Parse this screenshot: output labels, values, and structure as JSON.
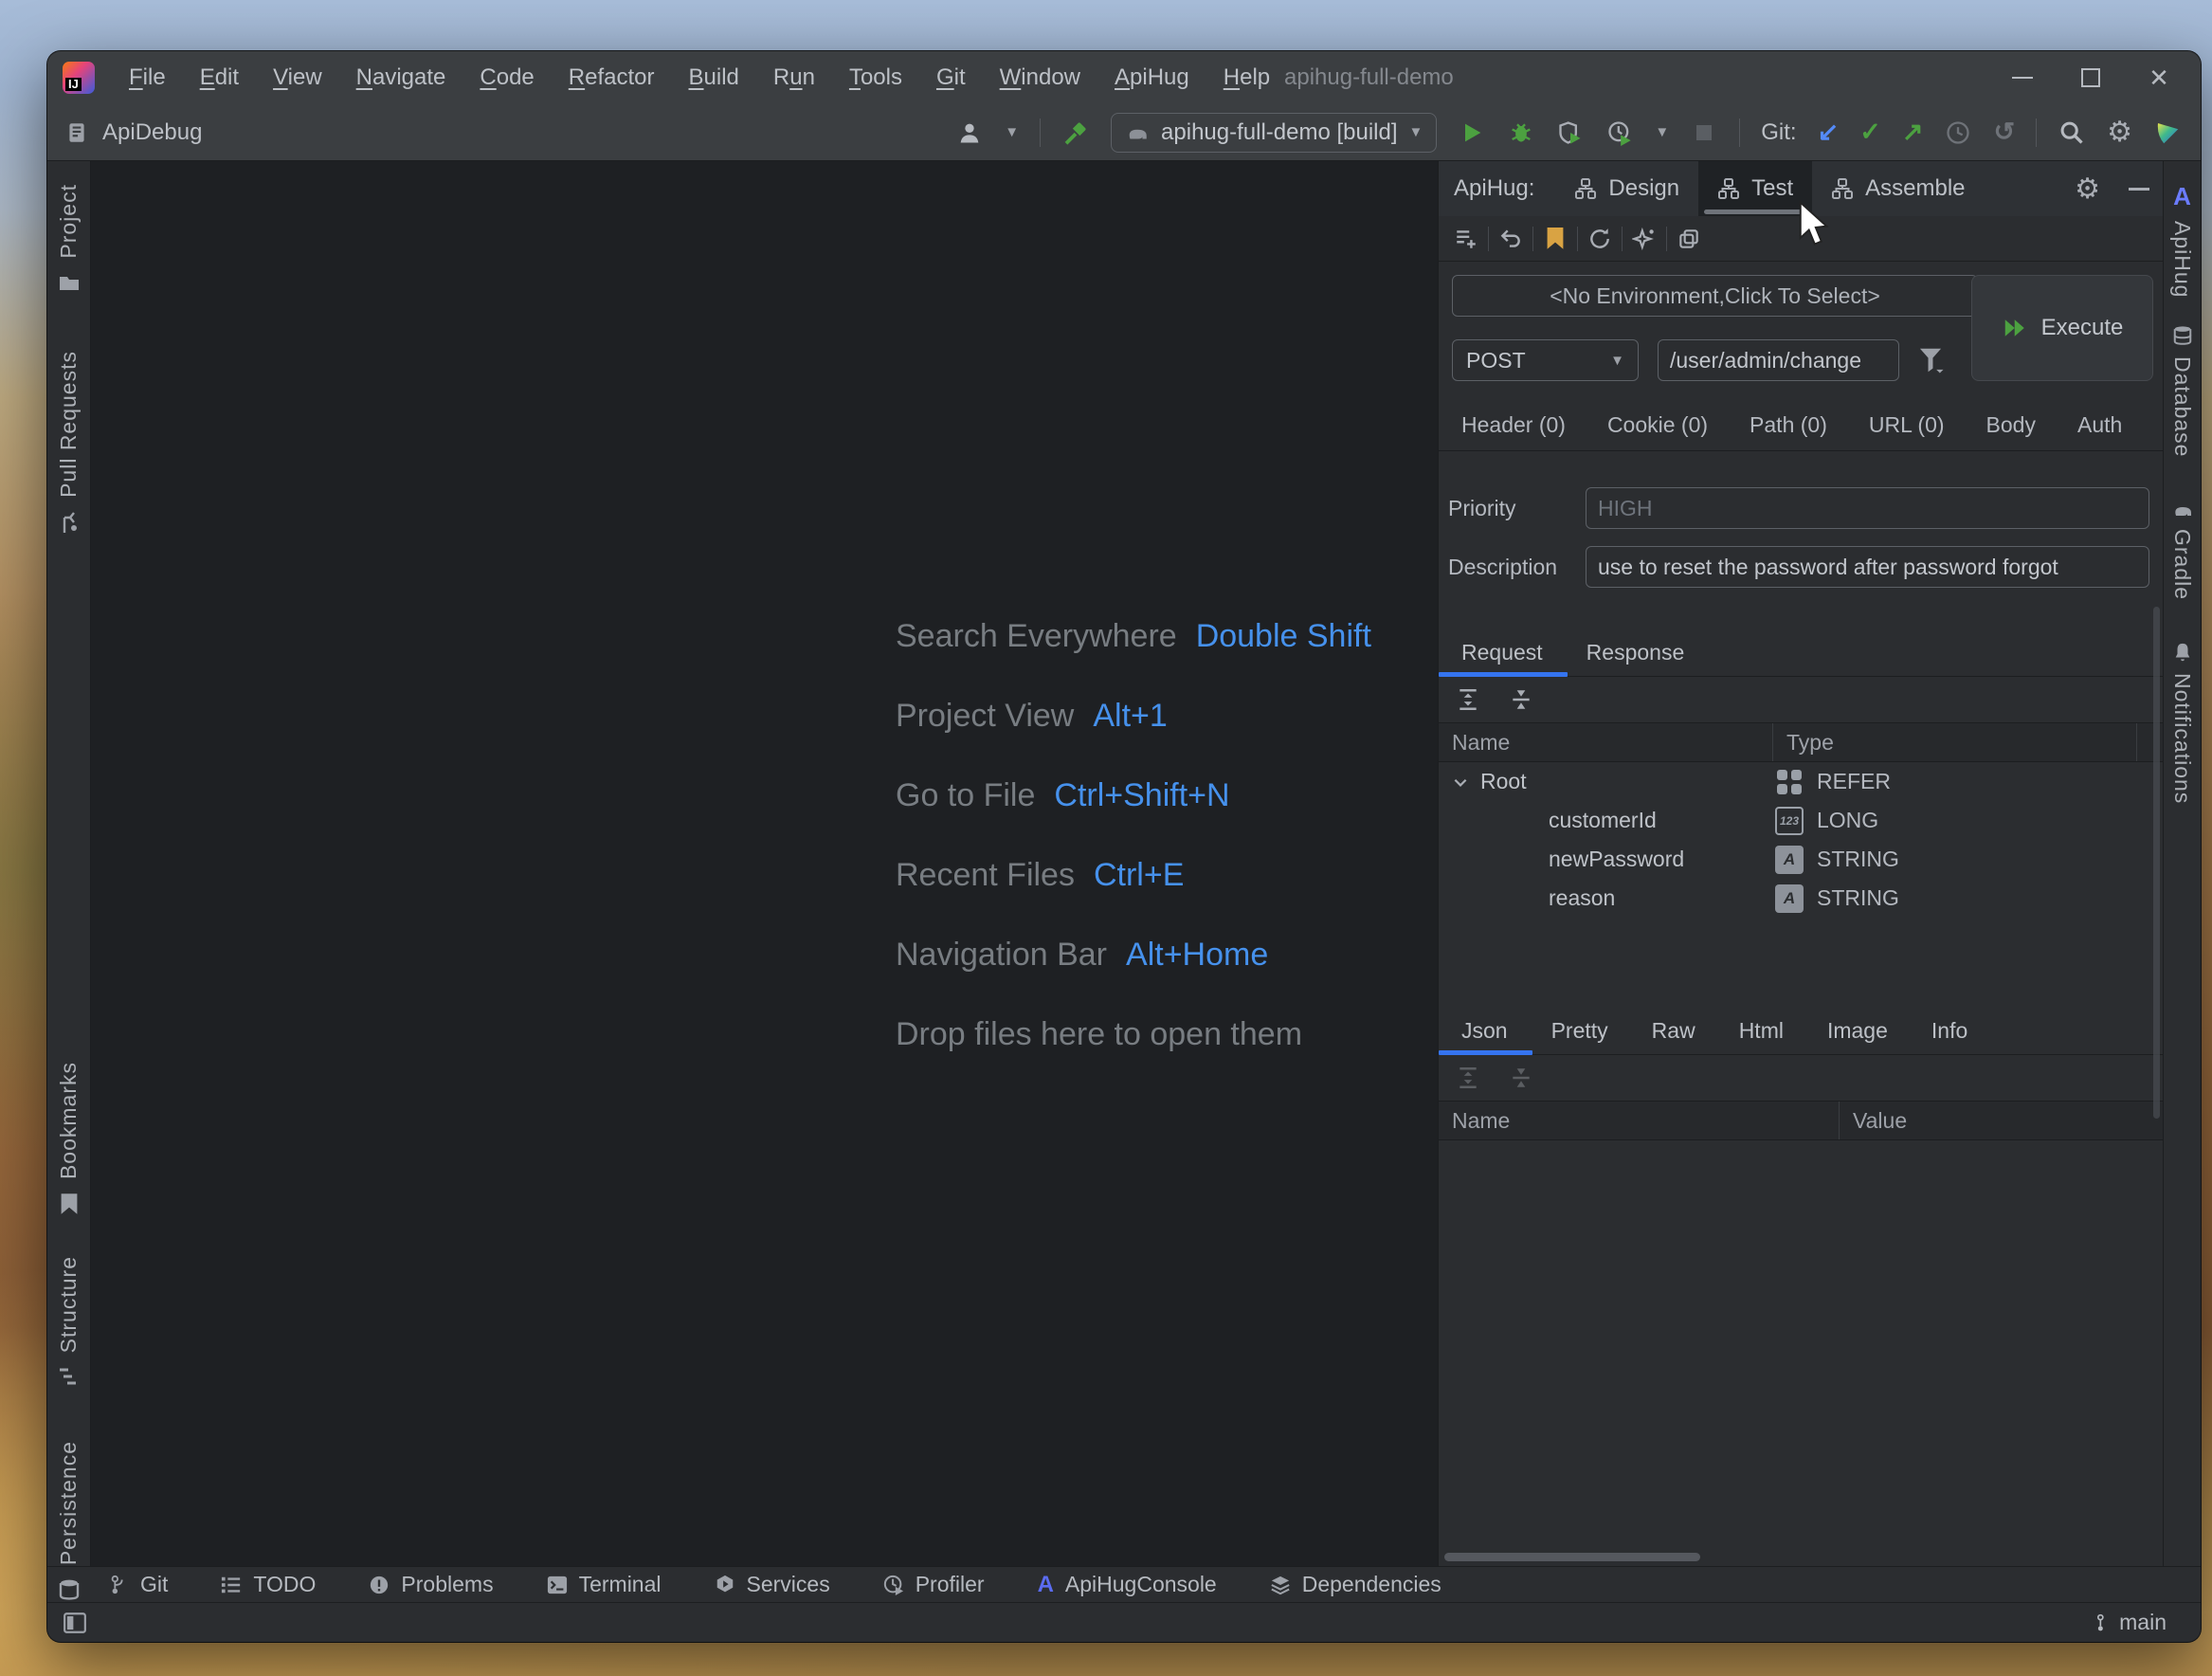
{
  "window": {
    "title": "apihug-full-demo",
    "controls": [
      "minimize",
      "maximize",
      "close"
    ]
  },
  "menu": {
    "items": [
      {
        "label": "File"
      },
      {
        "label": "Edit"
      },
      {
        "label": "View"
      },
      {
        "label": "Navigate"
      },
      {
        "label": "Code"
      },
      {
        "label": "Refactor"
      },
      {
        "label": "Build"
      },
      {
        "label": "Run",
        "mi": 1
      },
      {
        "label": "Tools"
      },
      {
        "label": "Git"
      },
      {
        "label": "Window"
      },
      {
        "label": "ApiHug"
      },
      {
        "label": "Help"
      }
    ]
  },
  "toolbar": {
    "tool_label": "ApiDebug",
    "run_config": "apihug-full-demo [build]",
    "git_label": "Git:"
  },
  "left_stripe": {
    "items": [
      "Project",
      "Pull Requests",
      "Bookmarks",
      "Structure",
      "Persistence"
    ]
  },
  "right_stripe": {
    "items": [
      "ApiHug",
      "Database",
      "Gradle",
      "Notifications"
    ]
  },
  "editor": {
    "shortcuts": [
      {
        "label": "Search Everywhere",
        "keys": "Double Shift"
      },
      {
        "label": "Project View",
        "keys": "Alt+1"
      },
      {
        "label": "Go to File",
        "keys": "Ctrl+Shift+N"
      },
      {
        "label": "Recent Files",
        "keys": "Ctrl+E"
      },
      {
        "label": "Navigation Bar",
        "keys": "Alt+Home"
      }
    ],
    "drop_hint": "Drop files here to open them"
  },
  "apihug": {
    "panel_label": "ApiHug:",
    "tabs": [
      {
        "label": "Design"
      },
      {
        "label": "Test",
        "selected": true
      },
      {
        "label": "Assemble"
      }
    ],
    "environment": "<No Environment,Click To Select>",
    "execute_label": "Execute",
    "method": "POST",
    "url": "/user/admin/change",
    "param_tabs": [
      "Header (0)",
      "Cookie (0)",
      "Path (0)",
      "URL (0)",
      "Body",
      "Auth"
    ],
    "priority": {
      "label": "Priority",
      "placeholder": "HIGH"
    },
    "description": {
      "label": "Description",
      "value": "use to reset the password after password forgot"
    },
    "rr_tabs": [
      {
        "label": "Request",
        "selected": true
      },
      {
        "label": "Response"
      }
    ],
    "request_table": {
      "columns": [
        "Name",
        "Type"
      ],
      "rows": [
        {
          "name": "Root",
          "type": "REFER",
          "icon": "refer",
          "level": 0,
          "expanded": true
        },
        {
          "name": "customerId",
          "type": "LONG",
          "icon": "long",
          "level": 1
        },
        {
          "name": "newPassword",
          "type": "STRING",
          "icon": "string",
          "level": 1
        },
        {
          "name": "reason",
          "type": "STRING",
          "icon": "string",
          "level": 1
        }
      ]
    },
    "view_tabs": [
      {
        "label": "Json",
        "selected": true
      },
      {
        "label": "Pretty"
      },
      {
        "label": "Raw"
      },
      {
        "label": "Html"
      },
      {
        "label": "Image"
      },
      {
        "label": "Info"
      }
    ],
    "response_table": {
      "columns": [
        "Name",
        "Value"
      ]
    }
  },
  "bottom_bar": {
    "items": [
      "Git",
      "TODO",
      "Problems",
      "Terminal",
      "Services",
      "Profiler",
      "ApiHugConsole",
      "Dependencies"
    ]
  },
  "status_bar": {
    "branch": "main"
  }
}
